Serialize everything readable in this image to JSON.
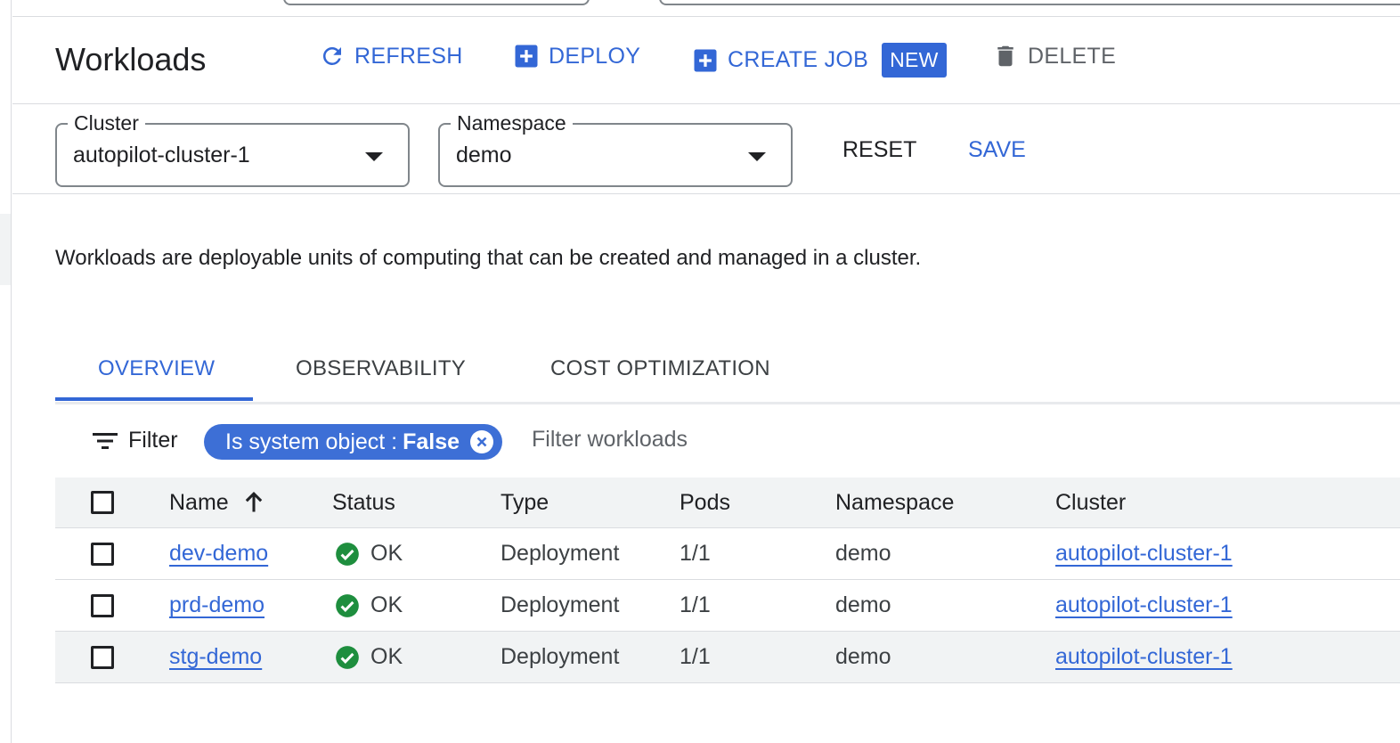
{
  "header": {
    "title": "Workloads",
    "actions": {
      "refresh": "REFRESH",
      "deploy": "DEPLOY",
      "create_job": "CREATE JOB",
      "new_badge": "NEW",
      "delete": "DELETE"
    }
  },
  "selectors": {
    "cluster": {
      "label": "Cluster",
      "value": "autopilot-cluster-1"
    },
    "namespace": {
      "label": "Namespace",
      "value": "demo"
    },
    "reset": "RESET",
    "save": "SAVE"
  },
  "description": "Workloads are deployable units of computing that can be created and managed in a cluster.",
  "tabs": [
    {
      "label": "OVERVIEW",
      "active": true
    },
    {
      "label": "OBSERVABILITY",
      "active": false
    },
    {
      "label": "COST OPTIMIZATION",
      "active": false
    }
  ],
  "filter": {
    "label": "Filter",
    "chip_key": "Is system object :",
    "chip_value": "False",
    "placeholder": "Filter workloads"
  },
  "table": {
    "columns": [
      "Name",
      "Status",
      "Type",
      "Pods",
      "Namespace",
      "Cluster"
    ],
    "sort_column": "Name",
    "sort_direction": "ascending",
    "rows": [
      {
        "name": "dev-demo",
        "status": "OK",
        "type": "Deployment",
        "pods": "1/1",
        "namespace": "demo",
        "cluster": "autopilot-cluster-1"
      },
      {
        "name": "prd-demo",
        "status": "OK",
        "type": "Deployment",
        "pods": "1/1",
        "namespace": "demo",
        "cluster": "autopilot-cluster-1"
      },
      {
        "name": "stg-demo",
        "status": "OK",
        "type": "Deployment",
        "pods": "1/1",
        "namespace": "demo",
        "cluster": "autopilot-cluster-1"
      }
    ]
  },
  "colors": {
    "accent": "#3367d6",
    "ok": "#1e8e3e",
    "text": "#202124",
    "muted": "#5f6368"
  }
}
